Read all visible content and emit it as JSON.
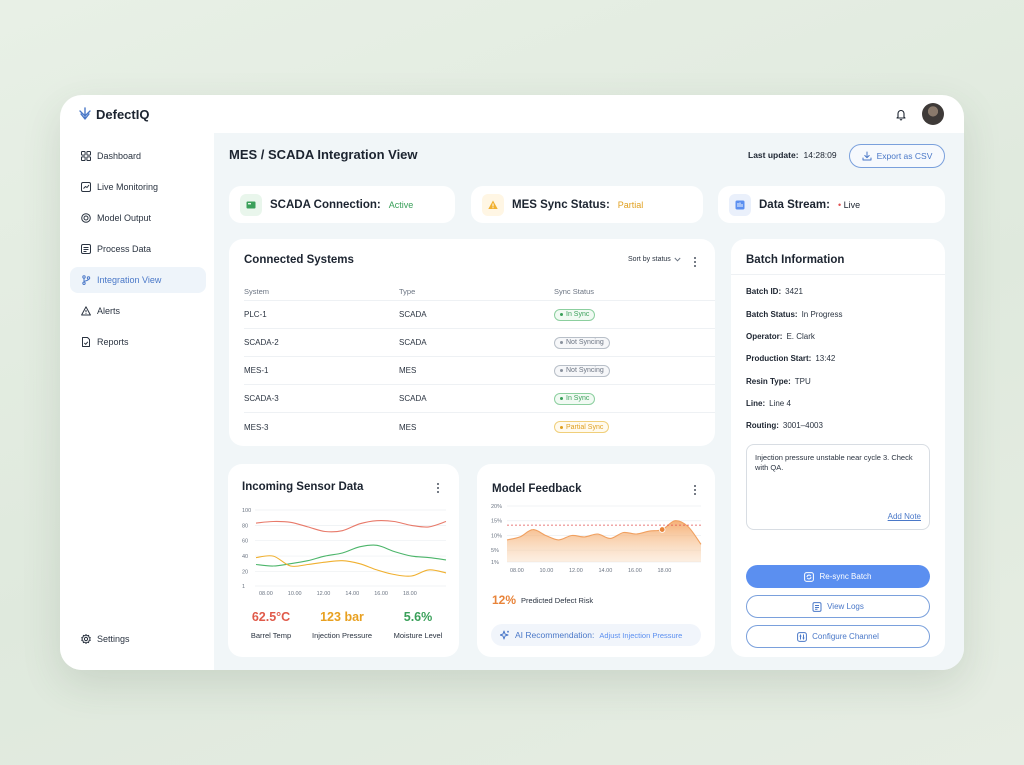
{
  "app": {
    "name": "DefectIQ"
  },
  "sidebar": {
    "items": [
      {
        "label": "Dashboard",
        "icon": "grid-icon"
      },
      {
        "label": "Live Monitoring",
        "icon": "monitor-icon"
      },
      {
        "label": "Model Output",
        "icon": "target-icon"
      },
      {
        "label": "Process Data",
        "icon": "database-icon"
      },
      {
        "label": "Integration View",
        "icon": "branch-icon",
        "active": true
      },
      {
        "label": "Alerts",
        "icon": "alert-icon"
      },
      {
        "label": "Reports",
        "icon": "file-icon"
      }
    ],
    "settings_label": "Settings"
  },
  "header": {
    "title": "MES / SCADA Integration View",
    "last_update_label": "Last update:",
    "last_update_value": "14:28:09",
    "export_label": "Export as CSV"
  },
  "status": {
    "scada": {
      "label": "SCADA Connection:",
      "value": "Active",
      "color": "#3aa05a"
    },
    "mes": {
      "label": "MES Sync Status:",
      "value": "Partial",
      "color": "#e0a020"
    },
    "stream": {
      "label": "Data Stream:",
      "value": "Live",
      "dot_color": "#e05050"
    }
  },
  "systems": {
    "title": "Connected Systems",
    "sort_label": "Sort by status",
    "headers": [
      "System",
      "Type",
      "Sync Status"
    ],
    "rows": [
      {
        "system": "PLC-1",
        "type": "SCADA",
        "status": "In Sync",
        "tone": "green"
      },
      {
        "system": "SCADA-2",
        "type": "SCADA",
        "status": "Not Syncing",
        "tone": "gray"
      },
      {
        "system": "MES-1",
        "type": "MES",
        "status": "Not Syncing",
        "tone": "gray"
      },
      {
        "system": "SCADA-3",
        "type": "SCADA",
        "status": "In Sync",
        "tone": "green"
      },
      {
        "system": "MES-3",
        "type": "MES",
        "status": "Partial Sync",
        "tone": "amber"
      }
    ]
  },
  "batch": {
    "title": "Batch Information",
    "fields": [
      {
        "label": "Batch ID:",
        "value": "3421"
      },
      {
        "label": "Batch Status:",
        "value": "In Progress"
      },
      {
        "label": "Operator:",
        "value": "E. Clark"
      },
      {
        "label": "Production Start:",
        "value": "13:42"
      },
      {
        "label": "Resin Type:",
        "value": "TPU"
      },
      {
        "label": "Line:",
        "value": "Line 4"
      },
      {
        "label": "Routing:",
        "value": "3001–4003"
      }
    ],
    "note": "Injection pressure unstable near cycle 3. Check with QA.",
    "add_note_label": "Add Note",
    "resync_label": "Re-sync Batch",
    "logs_label": "View Logs",
    "configure_label": "Configure Channel"
  },
  "sensor": {
    "title": "Incoming Sensor Data",
    "metrics": [
      {
        "value": "62.5°C",
        "label": "Barrel Temp",
        "color": "#e05a4a"
      },
      {
        "value": "123 bar",
        "label": "Injection Pressure",
        "color": "#e8a020"
      },
      {
        "value": "5.6%",
        "label": "Moisture Level",
        "color": "#3aa05a"
      }
    ]
  },
  "feedback": {
    "title": "Model Feedback",
    "risk_value": "12%",
    "risk_label": "Predicted Defect Risk",
    "ai_label": "AI Recommendation:",
    "ai_action": "Adjust Injection Pressure"
  },
  "chart_data": [
    {
      "type": "line",
      "x": [
        "08.00",
        "10.00",
        "12.00",
        "14.00",
        "16.00",
        "18.00"
      ],
      "yticks": [
        1,
        20,
        40,
        60,
        80,
        100
      ],
      "ylim": [
        1,
        100
      ],
      "grid": true,
      "series": [
        {
          "color": "#e87a6a",
          "values": [
            83,
            85,
            84,
            78,
            72,
            73,
            82,
            86,
            85,
            80,
            78,
            85
          ]
        },
        {
          "color": "#4cb56a",
          "values": [
            29,
            27,
            30,
            34,
            40,
            44,
            52,
            54,
            46,
            40,
            38,
            35
          ]
        },
        {
          "color": "#f0b030",
          "values": [
            38,
            40,
            27,
            29,
            32,
            34,
            30,
            22,
            16,
            14,
            22,
            18
          ]
        }
      ]
    },
    {
      "type": "area",
      "x": [
        "08.00",
        "10.00",
        "12.00",
        "14.00",
        "16.00",
        "18.00"
      ],
      "yticks": [
        "1%",
        "5%",
        "10%",
        "15%",
        "20%"
      ],
      "ylim": [
        1,
        20
      ],
      "threshold": 13.5,
      "grid": true,
      "series": [
        {
          "color": "#f0a060",
          "values": [
            8.5,
            9.5,
            12,
            10,
            8.5,
            10,
            9.5,
            10.5,
            9,
            11,
            10.5,
            11.5,
            12,
            15,
            13,
            7
          ]
        }
      ]
    }
  ]
}
